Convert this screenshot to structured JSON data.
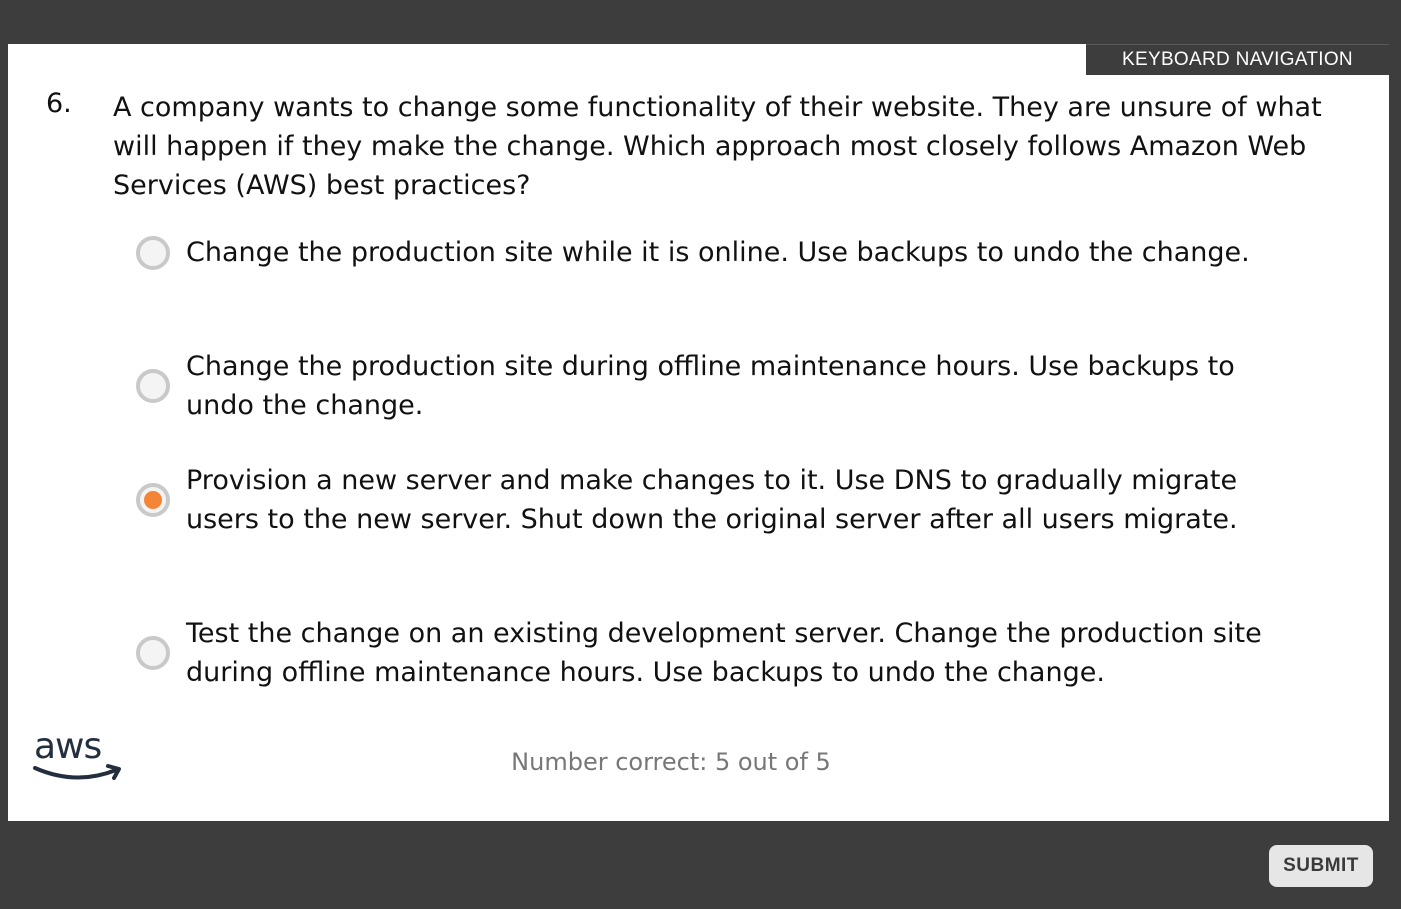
{
  "header": {
    "keyboard_navigation_label": "KEYBOARD NAVIGATION"
  },
  "question": {
    "number": "6.",
    "text": "A company wants to change some functionality of their website. They are unsure of what will happen if they make the change. Which approach most closely follows Amazon Web Services (AWS) best practices?"
  },
  "options": [
    {
      "text": "Change the production site while it is online. Use backups to undo the change.",
      "selected": false
    },
    {
      "text": "Change the production site during offline maintenance hours. Use backups to undo the change.",
      "selected": false
    },
    {
      "text": "Provision a new server and make changes to it. Use DNS to gradually migrate users to the new server.  Shut down the original server after all users migrate.",
      "selected": true
    },
    {
      "text": "Test the change on an existing development server. Change the production site during offline maintenance hours. Use backups to undo the change.",
      "selected": false
    }
  ],
  "footer": {
    "logo_text": "aws",
    "score_text": "Number correct: 5 out of 5",
    "submit_label": "SUBMIT"
  },
  "colors": {
    "background": "#3d3d3d",
    "panel": "#ffffff",
    "radio_selected": "#f58536",
    "radio_border": "#c9c9c9",
    "aws_logo_text": "#232f3e"
  }
}
